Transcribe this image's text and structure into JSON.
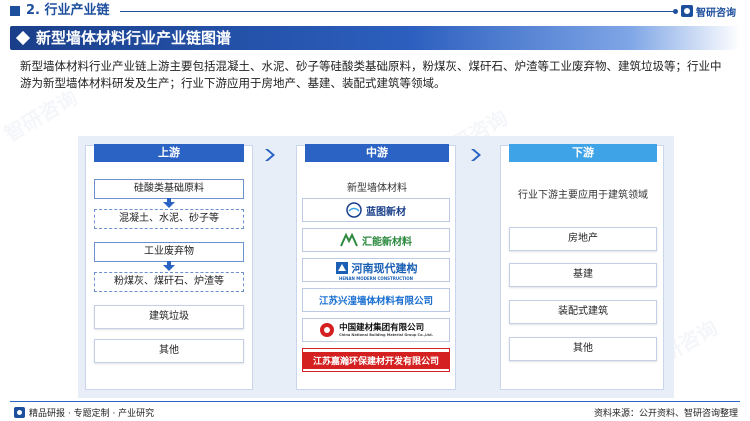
{
  "section": {
    "title": "2. 行业产业链"
  },
  "brand": {
    "name": "智研咨询"
  },
  "title": "新型墙体材料行业产业链图谱",
  "description": "新型墙体材料行业产业链上游主要包括混凝土、水泥、砂子等硅酸类基础原料，粉煤灰、煤矸石、炉渣等工业废弃物、建筑垃圾等；行业中游为新型墙体材料研发及生产；行业下游应用于房地产、基建、装配式建筑等领域。",
  "upstream": {
    "header": "上游",
    "groups": [
      {
        "title": "硅酸类基础原料",
        "detail": "混凝土、水泥、砂子等"
      },
      {
        "title": "工业废弃物",
        "detail": "粉煤灰、煤矸石、炉渣等"
      }
    ],
    "items": [
      "建筑垃圾",
      "其他"
    ]
  },
  "midstream": {
    "header": "中游",
    "label": "新型墙体材料",
    "logos": [
      {
        "name": "蓝图新材",
        "color": "#1a3f8a",
        "icon": "lantu-logo-icon"
      },
      {
        "name": "汇能新材料",
        "color": "#2c8a3e",
        "icon": "huineng-logo-icon"
      },
      {
        "name": "河南现代建构",
        "sub": "HENAN MODERN CONSTRUCTION",
        "color": "#1a5fb4",
        "icon": "henan-logo-icon"
      },
      {
        "name": "江苏兴湟墙体材料有限公司",
        "color": "#1a6fd0",
        "icon": ""
      },
      {
        "name": "中国建材集团有限公司",
        "sub": "China National Building Material Group Co.,Ltd.",
        "color": "#111111",
        "icon": "cnbm-logo-icon"
      },
      {
        "name": "江苏嘉瀚环保建材开发有限公司",
        "color": "#ffffff",
        "bg": "#d42020",
        "icon": ""
      }
    ]
  },
  "downstream": {
    "header": "下游",
    "label": "行业下游主要应用于建筑领域",
    "items": [
      "房地产",
      "基建",
      "装配式建筑",
      "其他"
    ]
  },
  "footer": {
    "left": "精品研报 · 专题定制 · 产业研究",
    "right": "资料来源：公开资料、智研咨询整理"
  },
  "colors": {
    "primary": "#1e4f9c",
    "accent": "#2a63c4",
    "downstream": "#3fa3e8"
  }
}
